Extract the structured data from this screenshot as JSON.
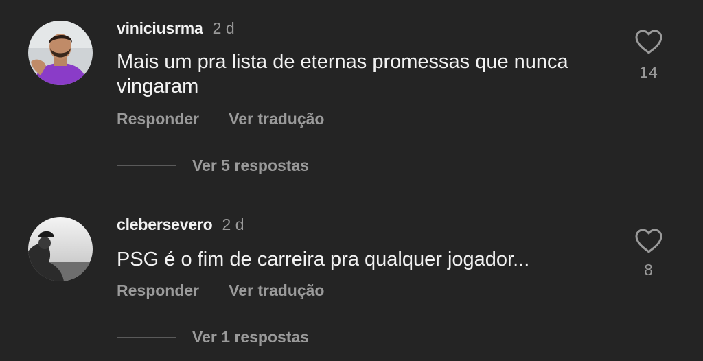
{
  "comments": [
    {
      "username": "viniciusrma",
      "time": "2 d",
      "text": "Mais um pra lista de eternas promessas que nunca vingaram",
      "reply_label": "Responder",
      "translate_label": "Ver tradução",
      "view_replies_label": "Ver 5 respostas",
      "likes": "14"
    },
    {
      "username": "clebersevero",
      "time": "2 d",
      "text": "PSG é o fim de carreira pra qualquer jogador...",
      "reply_label": "Responder",
      "translate_label": "Ver tradução",
      "view_replies_label": "Ver 1 respostas",
      "likes": "8"
    }
  ],
  "icons": {
    "like": "heart-outline-icon"
  },
  "colors": {
    "background": "#242424",
    "primary_text": "#f2f2f2",
    "secondary_text": "#9a9a9a"
  }
}
